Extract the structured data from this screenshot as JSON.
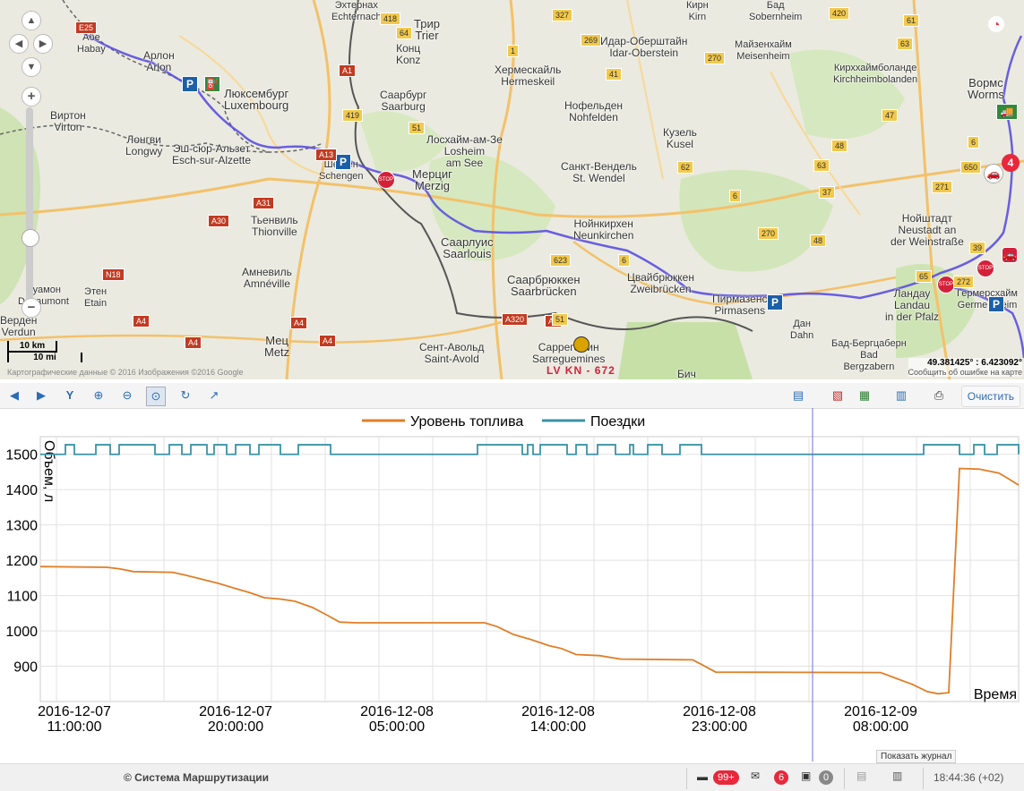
{
  "map": {
    "labels": [
      {
        "text": "Арлон\nArlon"
      },
      {
        "text": "Абе\nHabay"
      },
      {
        "text": "Люксембург\nLuxembourg"
      },
      {
        "text": "Виртон\nVirton"
      },
      {
        "text": "Лонгви\nLongwy"
      },
      {
        "text": "Эш-сюр-Альзет\nEsch-sur-Alzette"
      },
      {
        "text": "Шенген\nSchengen"
      },
      {
        "text": "Тьенвиль\nThionville"
      },
      {
        "text": "Амневиль\nAmnéville"
      },
      {
        "text": "Дуамон\nDouaumont"
      },
      {
        "text": "Этен\nEtain"
      },
      {
        "text": "Верден\nVerdun"
      },
      {
        "text": "Мец\nMetz"
      },
      {
        "text": "Трир\nTrier"
      },
      {
        "text": "Конц\nKonz"
      },
      {
        "text": "Хермескайль\nHermeskeil"
      },
      {
        "text": "Саарбург\nSaarburg"
      },
      {
        "text": "Лосхайм-ам-Зе\nLosheim\nam See"
      },
      {
        "text": "Мерциг\nMerzig"
      },
      {
        "text": "Саарлуис\nSaarlouis"
      },
      {
        "text": "Саарбрюккен\nSaarbrücken"
      },
      {
        "text": "Сент-Авольд\nSaint-Avold"
      },
      {
        "text": "Саррегемин\nSarreguemines"
      },
      {
        "text": "Идар-Оберштайн\nIdar-Oberstein"
      },
      {
        "text": "Нофельден\nNohfelden"
      },
      {
        "text": "Кузель\nKusel"
      },
      {
        "text": "Санкт-Вендель\nSt. Wendel"
      },
      {
        "text": "Нойнкирхен\nNeunkirchen"
      },
      {
        "text": "Цвайбрюккен\nZweibrücken"
      },
      {
        "text": "Пирмазенс\nPirmasens"
      },
      {
        "text": "Дан\nDahn"
      },
      {
        "text": "Бич"
      },
      {
        "text": "Кирн\nKirn"
      },
      {
        "text": "Бад\nSobernheim"
      },
      {
        "text": "Майзенхайм\nMeisenheim"
      },
      {
        "text": "Кирххаймболанде\nKirchheimbolanden"
      },
      {
        "text": "Вормс\nWorms"
      },
      {
        "text": "Нойштадт\nNeustadt an\nder Weinstraße"
      },
      {
        "text": "Ландау\nLandau\nin der Pfalz"
      },
      {
        "text": "Гермерсхайм\nGermersheim"
      },
      {
        "text": "Бад-Бергцаберн\nBad\nBergzabern"
      },
      {
        "text": "Эхтернах\nEchternach"
      }
    ],
    "road_badges": [
      "E25",
      "418",
      "327",
      "269",
      "420",
      "61",
      "64",
      "A1",
      "1",
      "41",
      "270",
      "63",
      "419",
      "51",
      "47",
      "A13",
      "A31",
      "A30",
      "A4",
      "N18",
      "A320",
      "623",
      "6",
      "62",
      "6",
      "37",
      "48",
      "271",
      "39",
      "650",
      "65",
      "272",
      "63",
      "6",
      "270",
      "48",
      "A4",
      "A4",
      "A4",
      "A4",
      "51"
    ],
    "scale_km": "10 km",
    "scale_mi": "10 mi",
    "coords": "49.381425° : 6.423092°",
    "report_error": "Сообщить об ошибке на карте",
    "copyright": "Картографические данные © 2016 Изображения ©2016 Google",
    "vehicle_label": "LV KN - 672",
    "cluster_count": "4",
    "route_color": "#5b4fe0"
  },
  "toolbar": {
    "clear_label": "Очистить"
  },
  "chart_data": {
    "type": "line",
    "legend": [
      "Уровень топлива",
      "Поездки"
    ],
    "legend_position": "top-center",
    "ylabel": "Объем, л",
    "xlabel": "Время",
    "ylim": [
      800,
      1550
    ],
    "yticks": [
      900,
      1000,
      1100,
      1200,
      1300,
      1400,
      1500
    ],
    "x_ticks": [
      {
        "date": "2016-12-07",
        "time": "11:00:00",
        "h": 0
      },
      {
        "date": "2016-12-07",
        "time": "20:00:00",
        "h": 9
      },
      {
        "date": "2016-12-08",
        "time": "05:00:00",
        "h": 18
      },
      {
        "date": "2016-12-08",
        "time": "14:00:00",
        "h": 27
      },
      {
        "date": "2016-12-08",
        "time": "23:00:00",
        "h": 36
      },
      {
        "date": "2016-12-09",
        "time": "08:00:00",
        "h": 45
      }
    ],
    "xlim_h": [
      -1.9,
      52.7
    ],
    "cursor_h": 41.2,
    "grid": true,
    "series": [
      {
        "name": "Уровень топлива",
        "color": "#e07e27",
        "points": [
          [
            -1.9,
            1182
          ],
          [
            1.8,
            1180
          ],
          [
            2.5,
            1176
          ],
          [
            3.3,
            1168
          ],
          [
            5.5,
            1166
          ],
          [
            6.2,
            1158
          ],
          [
            7.0,
            1148
          ],
          [
            8.0,
            1135
          ],
          [
            9.0,
            1120
          ],
          [
            9.8,
            1108
          ],
          [
            10.6,
            1094
          ],
          [
            11.5,
            1090
          ],
          [
            12.3,
            1084
          ],
          [
            13.3,
            1066
          ],
          [
            14.2,
            1042
          ],
          [
            14.8,
            1025
          ],
          [
            15.7,
            1023
          ],
          [
            22.9,
            1023
          ],
          [
            23.6,
            1012
          ],
          [
            24.5,
            990
          ],
          [
            25.5,
            975
          ],
          [
            26.5,
            958
          ],
          [
            27.2,
            950
          ],
          [
            28.0,
            933
          ],
          [
            29.3,
            930
          ],
          [
            30.5,
            920
          ],
          [
            34.5,
            918
          ],
          [
            35.0,
            905
          ],
          [
            35.8,
            883
          ],
          [
            45.0,
            882
          ],
          [
            46.0,
            863
          ],
          [
            46.8,
            848
          ],
          [
            47.6,
            828
          ],
          [
            48.2,
            822
          ],
          [
            48.8,
            825
          ],
          [
            49.4,
            1460
          ],
          [
            50.5,
            1458
          ],
          [
            51.6,
            1447
          ],
          [
            52.1,
            1432
          ],
          [
            52.7,
            1413
          ]
        ]
      },
      {
        "name": "Поездки",
        "color": "#3a93a6",
        "base": 1500,
        "high": 1527,
        "intervals": [
          [
            -0.5,
            0
          ],
          [
            1.2,
            2.0
          ],
          [
            2.5,
            4.5
          ],
          [
            5.3,
            6.0
          ],
          [
            6.5,
            7.4
          ],
          [
            7.8,
            8.5
          ],
          [
            9.0,
            9.8
          ],
          [
            10.3,
            11.5
          ],
          [
            12.5,
            14.3
          ],
          [
            22.5,
            25.0
          ],
          [
            25.3,
            25.6
          ],
          [
            26.0,
            27.5
          ],
          [
            28.0,
            28.6
          ],
          [
            29.2,
            30.2
          ],
          [
            31.0,
            31.2
          ],
          [
            32.0,
            32.8
          ],
          [
            33.8,
            35.0
          ],
          [
            47.4,
            49.4
          ],
          [
            50.2,
            50.8
          ],
          [
            51.5,
            52.7
          ]
        ]
      }
    ]
  },
  "footer": {
    "brand": "© Система Маршрутизации",
    "messages_count": "99+",
    "mail_count": "6",
    "images_count": "0",
    "clock": "18:44:36 (+02)",
    "tooltip": "Показать журнал"
  }
}
